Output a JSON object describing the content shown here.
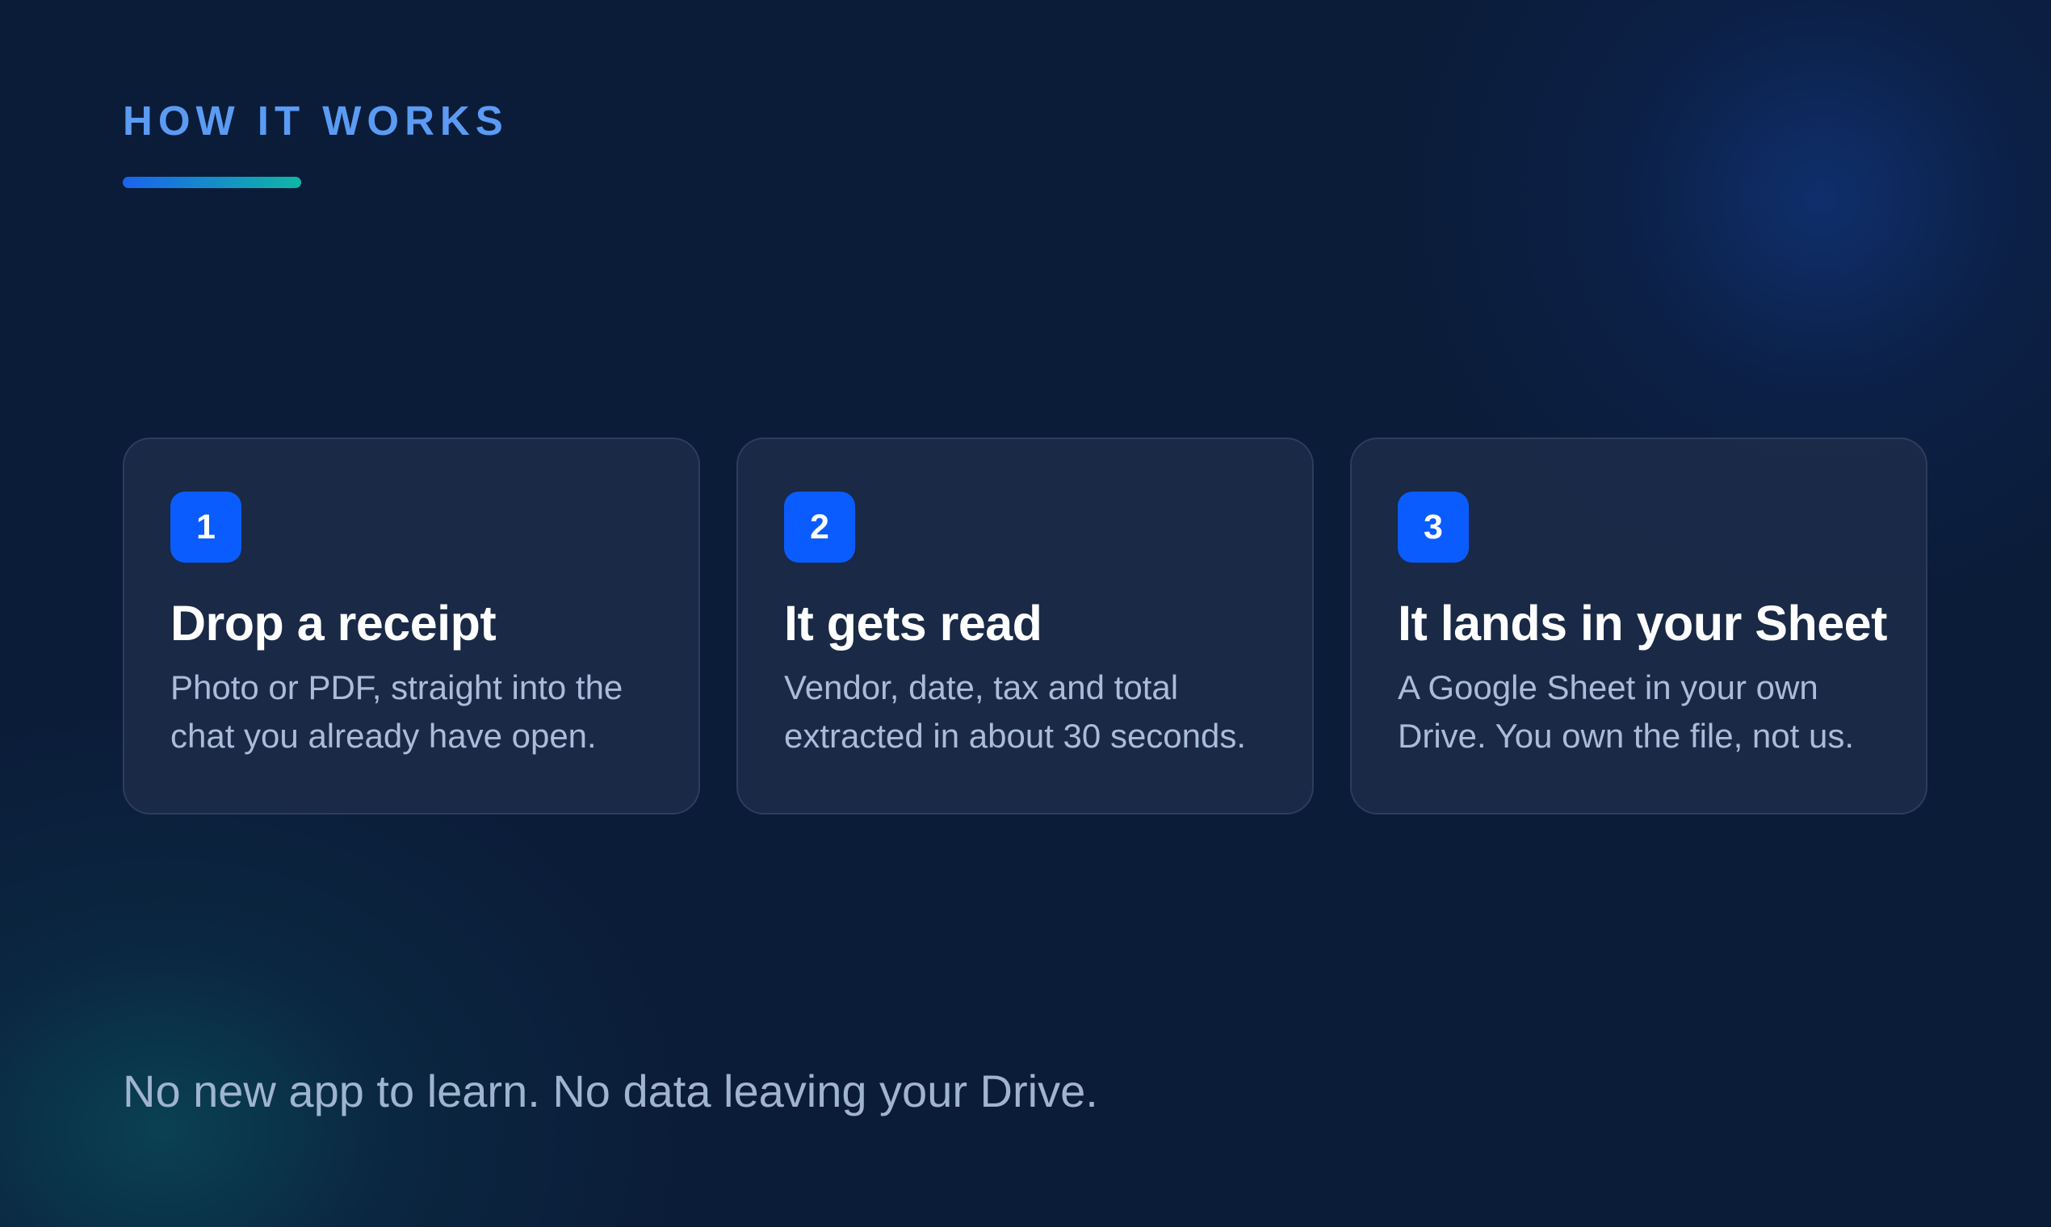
{
  "header": {
    "eyebrow": "HOW IT WORKS"
  },
  "steps": [
    {
      "number": "1",
      "title": "Drop a receipt",
      "description": "Photo or PDF, straight into the chat you already have open."
    },
    {
      "number": "2",
      "title": "It gets read",
      "description": "Vendor, date, tax and total extracted in about 30 seconds."
    },
    {
      "number": "3",
      "title": "It lands in your Sheet",
      "description": "A Google Sheet in your own Drive. You own the file, not us."
    }
  ],
  "footer": {
    "tagline": "No new app to learn. No data leaving your Drive."
  },
  "colors": {
    "background": "#0b1c38",
    "accent": "#0a5cff",
    "eyebrow": "#5b9bf4",
    "teal": "#0fb7a5",
    "card": "#1c2a46"
  }
}
